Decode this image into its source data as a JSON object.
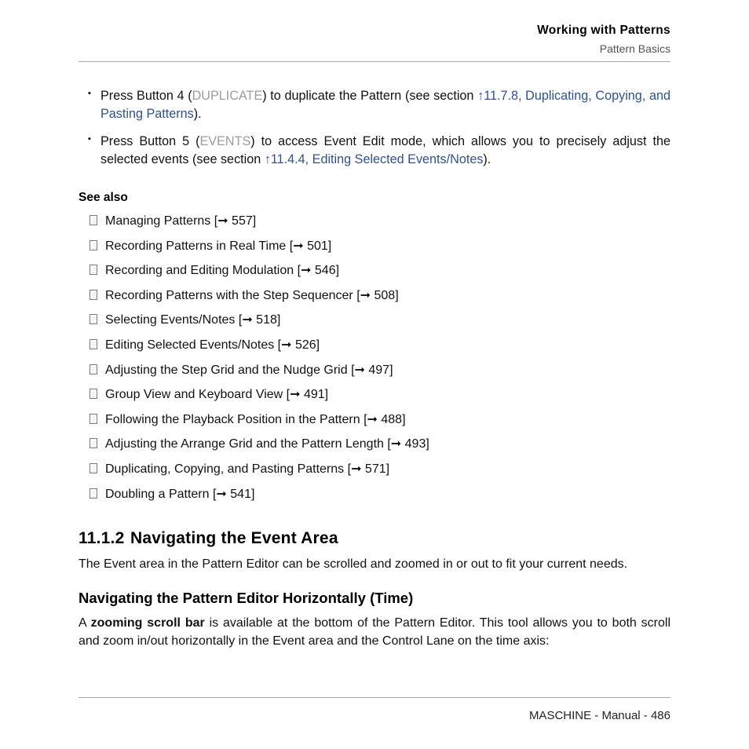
{
  "header": {
    "title": "Working with Patterns",
    "sub": "Pattern Basics"
  },
  "bullets": [
    {
      "pre": "Press Button 4 (",
      "ui": "DUPLICATE",
      "mid": ") to duplicate the Pattern (see section ",
      "ref": "↑11.7.8, Duplicating, Copying, and Pasting Patterns",
      "post": ")."
    },
    {
      "pre": "Press Button 5 (",
      "ui": "EVENTS",
      "mid": ") to access Event Edit mode, which allows you to precisely adjust the selected events (see section ",
      "ref": "↑11.4.4, Editing Selected Events/Notes",
      "post": ")."
    }
  ],
  "see_also": {
    "heading": "See also",
    "items": [
      {
        "title": "Managing Patterns",
        "page": "557"
      },
      {
        "title": "Recording Patterns in Real Time",
        "page": "501"
      },
      {
        "title": "Recording and Editing Modulation",
        "page": "546"
      },
      {
        "title": "Recording Patterns with the Step Sequencer",
        "page": "508"
      },
      {
        "title": "Selecting Events/Notes",
        "page": "518"
      },
      {
        "title": "Editing Selected Events/Notes",
        "page": "526"
      },
      {
        "title": "Adjusting the Step Grid and the Nudge Grid",
        "page": "497"
      },
      {
        "title": "Group View and Keyboard View",
        "page": "491"
      },
      {
        "title": "Following the Playback Position in the Pattern",
        "page": "488"
      },
      {
        "title": "Adjusting the Arrange Grid and the Pattern Length",
        "page": "493"
      },
      {
        "title": "Duplicating, Copying, and Pasting Patterns",
        "page": "571"
      },
      {
        "title": "Doubling a Pattern",
        "page": "541"
      }
    ]
  },
  "section": {
    "num": "11.1.2",
    "title": "Navigating the Event Area",
    "body": "The Event area in the Pattern Editor can be scrolled and zoomed in or out to fit your current needs."
  },
  "subsection": {
    "title": "Navigating the Pattern Editor Horizontally (Time)",
    "body_pre": "A ",
    "body_bold": "zooming scroll bar",
    "body_post": " is available at the bottom of the Pattern Editor. This tool allows you to both scroll and zoom in/out horizontally in the Event area and the Control Lane on the time axis:"
  },
  "footer": "MASCHINE - Manual - 486"
}
